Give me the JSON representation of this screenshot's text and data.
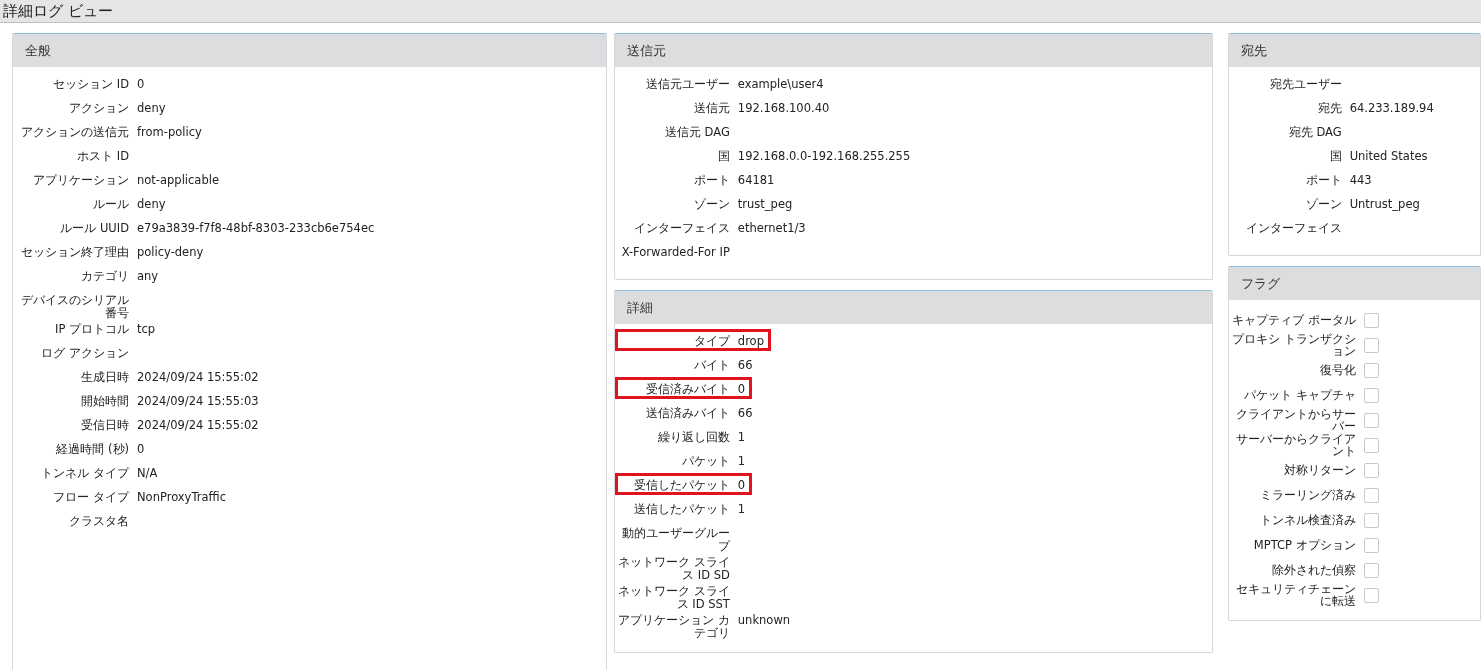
{
  "window": {
    "title": "詳細ログ ビュー"
  },
  "columns": [
    {
      "panels": [
        {
          "title": "全般",
          "rows": [
            {
              "label": "セッション ID",
              "value": "0",
              "highlighted": false
            },
            {
              "label": "アクション",
              "value": "deny",
              "highlighted": false
            },
            {
              "label": "アクションの送信元",
              "value": "from-policy",
              "highlighted": false
            },
            {
              "label": "ホスト ID",
              "value": "",
              "highlighted": false
            },
            {
              "label": "アプリケーション",
              "value": "not-applicable",
              "highlighted": false
            },
            {
              "label": "ルール",
              "value": "deny",
              "highlighted": false
            },
            {
              "label": "ルール UUID",
              "value": "e79a3839-f7f8-48bf-8303-233cb6e754ec",
              "highlighted": false
            },
            {
              "label": "セッション終了理由",
              "value": "policy-deny",
              "highlighted": false
            },
            {
              "label": "カテゴリ",
              "value": "any",
              "highlighted": false
            },
            {
              "label": "デバイスのシリアル番号",
              "value": "",
              "highlighted": false
            },
            {
              "label": "IP プロトコル",
              "value": "tcp",
              "highlighted": false
            },
            {
              "label": "ログ アクション",
              "value": "",
              "highlighted": false
            },
            {
              "label": "生成日時",
              "value": "2024/09/24 15:55:02",
              "highlighted": false
            },
            {
              "label": "開始時間",
              "value": "2024/09/24 15:55:03",
              "highlighted": false
            },
            {
              "label": "受信日時",
              "value": "2024/09/24 15:55:02",
              "highlighted": false
            },
            {
              "label": "経過時間 (秒)",
              "value": "0",
              "highlighted": false
            },
            {
              "label": "トンネル タイプ",
              "value": "N/A",
              "highlighted": false
            },
            {
              "label": "フロー タイプ",
              "value": "NonProxyTraffic",
              "highlighted": false
            },
            {
              "label": "クラスタ名",
              "value": "",
              "highlighted": false
            }
          ]
        }
      ]
    },
    {
      "panels": [
        {
          "title": "送信元",
          "rows": [
            {
              "label": "送信元ユーザー",
              "value": "example\\user4",
              "highlighted": false
            },
            {
              "label": "送信元",
              "value": "192.168.100.40",
              "highlighted": false
            },
            {
              "label": "送信元 DAG",
              "value": "",
              "highlighted": false
            },
            {
              "label": "国",
              "value": "192.168.0.0-192.168.255.255",
              "highlighted": false
            },
            {
              "label": "ポート",
              "value": "64181",
              "highlighted": false
            },
            {
              "label": "ゾーン",
              "value": "trust_peg",
              "highlighted": false
            },
            {
              "label": "インターフェイス",
              "value": "ethernet1/3",
              "highlighted": false
            },
            {
              "label": "X-Forwarded-For IP",
              "value": "",
              "highlighted": false
            }
          ]
        },
        {
          "title": "詳細",
          "rows": [
            {
              "label": "タイプ",
              "value": "drop",
              "highlighted": true
            },
            {
              "label": "バイト",
              "value": "66",
              "highlighted": false
            },
            {
              "label": "受信済みバイト",
              "value": "0",
              "highlighted": true
            },
            {
              "label": "送信済みバイト",
              "value": "66",
              "highlighted": false
            },
            {
              "label": "繰り返し回数",
              "value": "1",
              "highlighted": false
            },
            {
              "label": "パケット",
              "value": "1",
              "highlighted": false
            },
            {
              "label": "受信したパケット",
              "value": "0",
              "highlighted": true
            },
            {
              "label": "送信したパケット",
              "value": "1",
              "highlighted": false
            },
            {
              "label": "動的ユーザーグループ",
              "value": "",
              "highlighted": false
            },
            {
              "label": "ネットワーク スライス ID SD",
              "value": "",
              "highlighted": false
            },
            {
              "label": "ネットワーク スライス ID SST",
              "value": "",
              "highlighted": false
            },
            {
              "label": "アプリケーション カテゴリ",
              "value": "unknown",
              "highlighted": false
            }
          ]
        }
      ]
    },
    {
      "panels": [
        {
          "title": "宛先",
          "rows": [
            {
              "label": "宛先ユーザー",
              "value": "",
              "highlighted": false
            },
            {
              "label": "宛先",
              "value": "64.233.189.94",
              "highlighted": false
            },
            {
              "label": "宛先 DAG",
              "value": "",
              "highlighted": false
            },
            {
              "label": "国",
              "value": "United States",
              "highlighted": false
            },
            {
              "label": "ポート",
              "value": "443",
              "highlighted": false
            },
            {
              "label": "ゾーン",
              "value": "Untrust_peg",
              "highlighted": false
            },
            {
              "label": "インターフェイス",
              "value": "",
              "highlighted": false
            }
          ]
        },
        {
          "title": "フラグ",
          "flags": [
            {
              "label": "キャプティブ ポータル",
              "checked": false
            },
            {
              "label": "プロキシ トランザクション",
              "checked": false
            },
            {
              "label": "復号化",
              "checked": false
            },
            {
              "label": "パケット キャプチャ",
              "checked": false
            },
            {
              "label": "クライアントからサーバー",
              "checked": false
            },
            {
              "label": "サーバーからクライアント",
              "checked": false
            },
            {
              "label": "対称リターン",
              "checked": false
            },
            {
              "label": "ミラーリング済み",
              "checked": false
            },
            {
              "label": "トンネル検査済み",
              "checked": false
            },
            {
              "label": "MPTCP オプション",
              "checked": false
            },
            {
              "label": "除外された偵察",
              "checked": false
            },
            {
              "label": "セキュリティチェーンに転送",
              "checked": false
            }
          ]
        }
      ]
    }
  ]
}
